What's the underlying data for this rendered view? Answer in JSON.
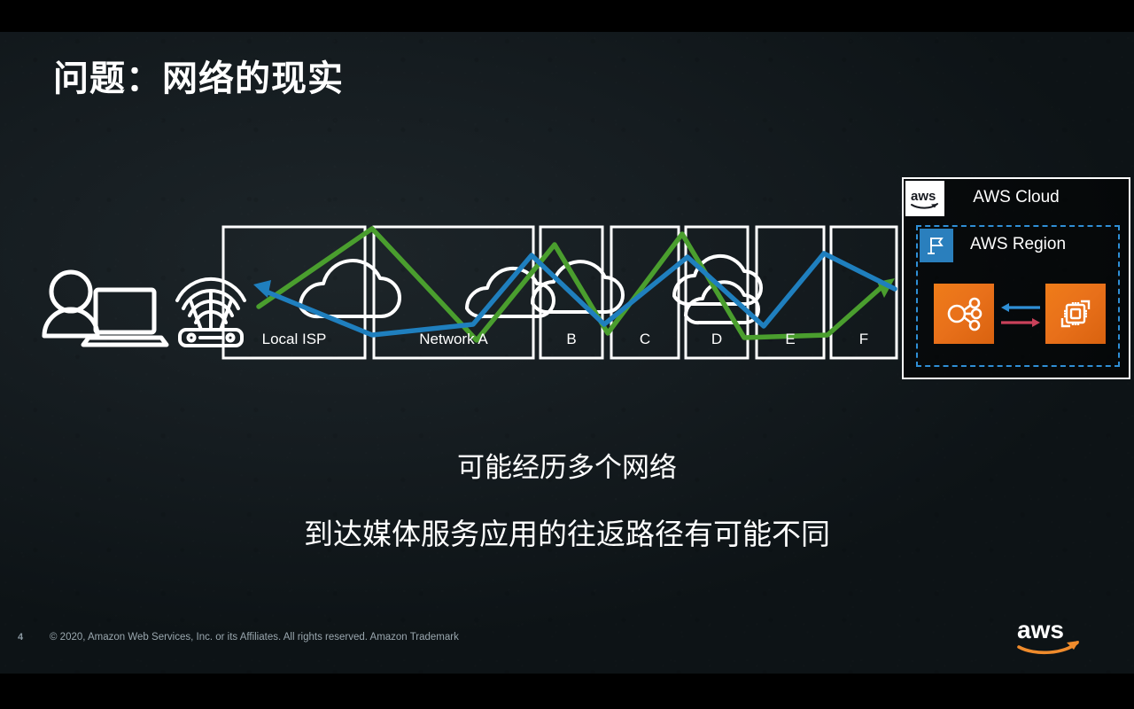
{
  "slide": {
    "title": "问题：网络的现实",
    "page_number": "4",
    "copyright": "© 2020, Amazon Web Services, Inc. or its Affiliates. All rights reserved. Amazon Trademark",
    "logo_text": "aws"
  },
  "captions": {
    "line1": "可能经历多个网络",
    "line2": "到达媒体服务应用的往返路径有可能不同"
  },
  "diagram": {
    "endpoint": {
      "user_icon": "user-with-laptop-icon",
      "router_icon": "wifi-router-icon"
    },
    "networks": [
      {
        "label": "Local ISP",
        "has_cloud": true
      },
      {
        "label": "Network A",
        "has_cloud": true
      },
      {
        "label": "B",
        "has_cloud": true
      },
      {
        "label": "C",
        "has_cloud": false
      },
      {
        "label": "D",
        "has_cloud": true
      },
      {
        "label": "E",
        "has_cloud": false
      },
      {
        "label": "F",
        "has_cloud": false
      }
    ],
    "paths": [
      {
        "name": "outbound-path",
        "color": "#4a9e2e",
        "direction": "to-aws"
      },
      {
        "name": "return-path",
        "color": "#1f7fbe",
        "direction": "to-user"
      }
    ]
  },
  "aws_cloud": {
    "label": "AWS Cloud",
    "badge_text": "aws",
    "region": {
      "label": "AWS Region",
      "badge_icon": "region-flag-icon",
      "services": [
        {
          "name": "network-hub-icon",
          "color": "#ec7211"
        },
        {
          "name": "compute-instance-icon",
          "color": "#ec7211"
        }
      ],
      "arrows": [
        {
          "name": "inbound-arrow",
          "color": "#2f8fd6",
          "direction": "left"
        },
        {
          "name": "outbound-arrow",
          "color": "#c9415a",
          "direction": "right"
        }
      ]
    }
  },
  "colors": {
    "background": "#161d21",
    "text": "#ffffff",
    "green_path": "#4a9e2e",
    "blue_path": "#1f7fbe",
    "aws_orange": "#ec7211",
    "aws_blue": "#2a7fbd",
    "footer_text": "#9aa7ae"
  }
}
